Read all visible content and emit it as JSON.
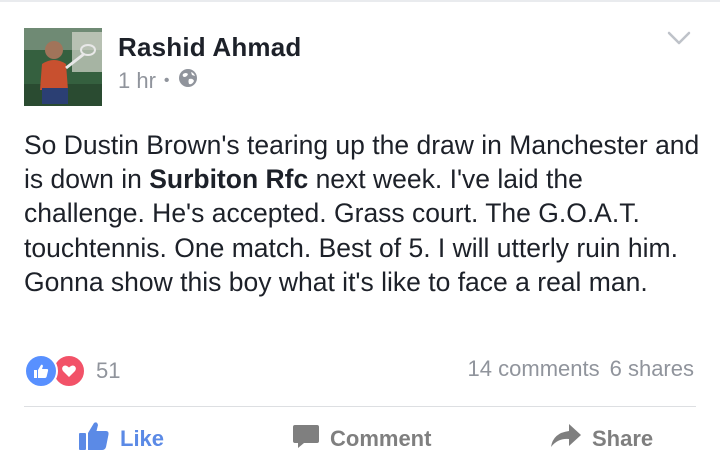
{
  "post": {
    "author": "Rashid Ahmad",
    "time": "1 hr",
    "separator": "•",
    "audience_icon": "globe-icon",
    "menu_icon": "chevron-down-icon",
    "body": {
      "part1": "So Dustin Brown's tearing up the draw in Manchester and is down in ",
      "bold": "Surbiton Rfc",
      "part2": " next week. I've laid the challenge. He's accepted. Grass court. The G.O.A.T. touchtennis. One match. Best of 5. I will utterly ruin him. Gonna show this boy what it's like to face a real man."
    },
    "reactions": {
      "types": [
        "like",
        "love"
      ],
      "count": "51"
    },
    "stats": {
      "comments": "14 comments",
      "shares": "6 shares"
    },
    "actions": {
      "like": "Like",
      "comment": "Comment",
      "share": "Share"
    },
    "colors": {
      "like_blue": "#5890ff",
      "love_red": "#f25268",
      "meta_gray": "#90949c"
    }
  }
}
